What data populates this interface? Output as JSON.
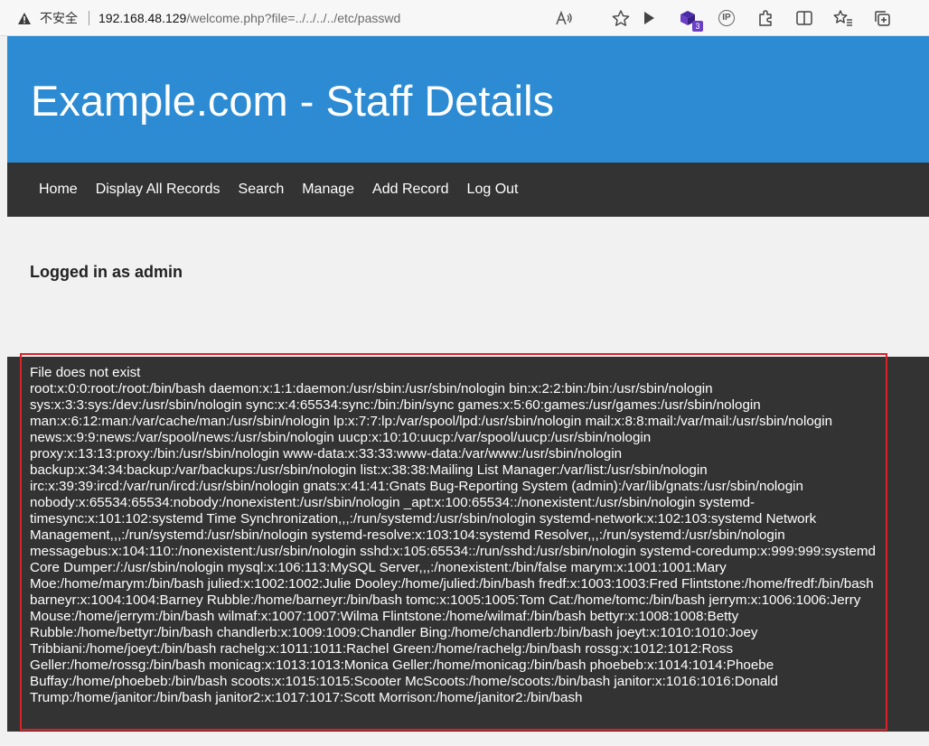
{
  "browser": {
    "insecure_label": "不安全",
    "url_host": "192.168.48.129",
    "url_path": "/welcome.php?file=../../../../etc/passwd",
    "extension_badge": "3",
    "ip_icon_text": "IP"
  },
  "site": {
    "title": "Example.com - Staff Details",
    "header_color": "#2c8bd3",
    "nav_color": "#333333"
  },
  "nav": {
    "items": [
      {
        "label": "Home"
      },
      {
        "label": "Display All Records"
      },
      {
        "label": "Search"
      },
      {
        "label": "Manage"
      },
      {
        "label": "Add Record"
      },
      {
        "label": "Log Out"
      }
    ]
  },
  "main": {
    "logged_in_text": "Logged in as admin"
  },
  "output": {
    "error_line": "File does not exist",
    "passwd_content": "root:x:0:0:root:/root:/bin/bash daemon:x:1:1:daemon:/usr/sbin:/usr/sbin/nologin bin:x:2:2:bin:/bin:/usr/sbin/nologin sys:x:3:3:sys:/dev:/usr/sbin/nologin sync:x:4:65534:sync:/bin:/bin/sync games:x:5:60:games:/usr/games:/usr/sbin/nologin man:x:6:12:man:/var/cache/man:/usr/sbin/nologin lp:x:7:7:lp:/var/spool/lpd:/usr/sbin/nologin mail:x:8:8:mail:/var/mail:/usr/sbin/nologin news:x:9:9:news:/var/spool/news:/usr/sbin/nologin uucp:x:10:10:uucp:/var/spool/uucp:/usr/sbin/nologin proxy:x:13:13:proxy:/bin:/usr/sbin/nologin www-data:x:33:33:www-data:/var/www:/usr/sbin/nologin backup:x:34:34:backup:/var/backups:/usr/sbin/nologin list:x:38:38:Mailing List Manager:/var/list:/usr/sbin/nologin irc:x:39:39:ircd:/var/run/ircd:/usr/sbin/nologin gnats:x:41:41:Gnats Bug-Reporting System (admin):/var/lib/gnats:/usr/sbin/nologin nobody:x:65534:65534:nobody:/nonexistent:/usr/sbin/nologin _apt:x:100:65534::/nonexistent:/usr/sbin/nologin systemd-timesync:x:101:102:systemd Time Synchronization,,,:/run/systemd:/usr/sbin/nologin systemd-network:x:102:103:systemd Network Management,,,:/run/systemd:/usr/sbin/nologin systemd-resolve:x:103:104:systemd Resolver,,,:/run/systemd:/usr/sbin/nologin messagebus:x:104:110::/nonexistent:/usr/sbin/nologin sshd:x:105:65534::/run/sshd:/usr/sbin/nologin systemd-coredump:x:999:999:systemd Core Dumper:/:/usr/sbin/nologin mysql:x:106:113:MySQL Server,,,:/nonexistent:/bin/false marym:x:1001:1001:Mary Moe:/home/marym:/bin/bash julied:x:1002:1002:Julie Dooley:/home/julied:/bin/bash fredf:x:1003:1003:Fred Flintstone:/home/fredf:/bin/bash barneyr:x:1004:1004:Barney Rubble:/home/barneyr:/bin/bash tomc:x:1005:1005:Tom Cat:/home/tomc:/bin/bash jerrym:x:1006:1006:Jerry Mouse:/home/jerrym:/bin/bash wilmaf:x:1007:1007:Wilma Flintstone:/home/wilmaf:/bin/bash bettyr:x:1008:1008:Betty Rubble:/home/bettyr:/bin/bash chandlerb:x:1009:1009:Chandler Bing:/home/chandlerb:/bin/bash joeyt:x:1010:1010:Joey Tribbiani:/home/joeyt:/bin/bash rachelg:x:1011:1011:Rachel Green:/home/rachelg:/bin/bash rossg:x:1012:1012:Ross Geller:/home/rossg:/bin/bash monicag:x:1013:1013:Monica Geller:/home/monicag:/bin/bash phoebeb:x:1014:1014:Phoebe Buffay:/home/phoebeb:/bin/bash scoots:x:1015:1015:Scooter McScoots:/home/scoots:/bin/bash janitor:x:1016:1016:Donald Trump:/home/janitor:/bin/bash janitor2:x:1017:1017:Scott Morrison:/home/janitor2:/bin/bash",
    "highlight_color": "#d92128"
  },
  "icons": {
    "warning": "warning-triangle-icon",
    "read_aloud": "read-aloud-icon",
    "favorite": "star-outline-icon",
    "play": "play-icon",
    "extension": "extension-cube-icon",
    "ip": "ip-lookup-icon",
    "puzzle": "extensions-puzzle-icon",
    "split": "split-screen-icon",
    "favorites": "favorites-list-icon",
    "collections": "collections-icon"
  }
}
